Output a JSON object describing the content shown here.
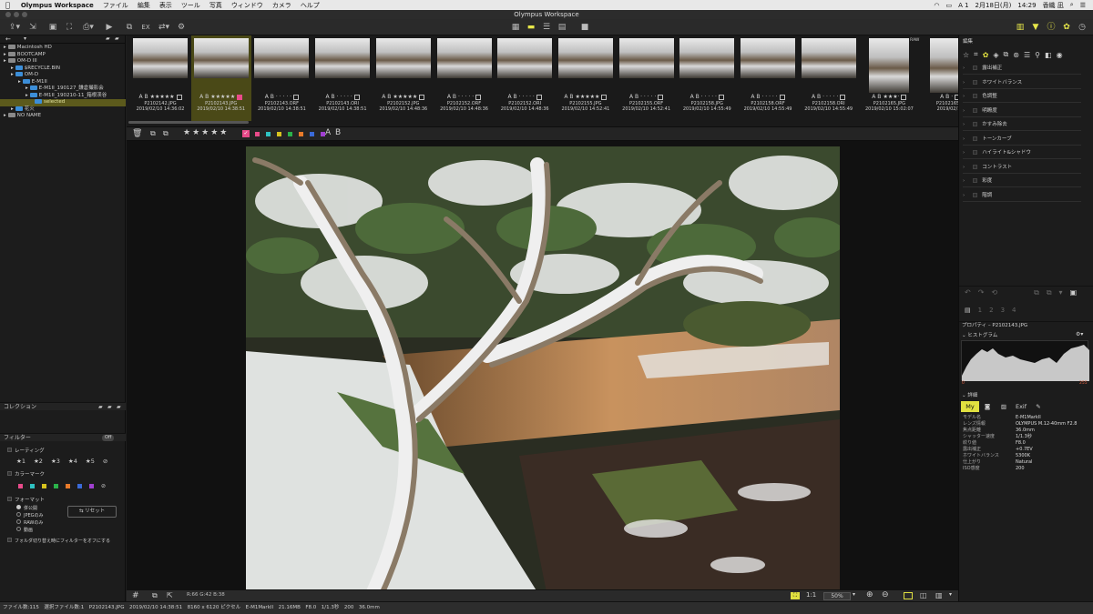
{
  "menubar": {
    "app": "Olympus Workspace",
    "items": [
      "ファイル",
      "編集",
      "表示",
      "ツール",
      "写真",
      "ウィンドウ",
      "カメラ",
      "ヘルプ"
    ],
    "right": [
      "A 1",
      "2月18日(月)",
      "14:29",
      "香織 凪"
    ]
  },
  "window": {
    "title": "Olympus Workspace"
  },
  "tree": [
    {
      "label": "Macintosh HD",
      "level": 1
    },
    {
      "label": "BOOTCAMP",
      "level": 1
    },
    {
      "label": "OM-D III",
      "level": 1
    },
    {
      "label": "$RECYCLE.BIN",
      "level": 2
    },
    {
      "label": "OM-D",
      "level": 2
    },
    {
      "label": "E-M1II",
      "level": 3
    },
    {
      "label": "E-M1II_190127_鎌倉撮影会",
      "level": 4
    },
    {
      "label": "E-M1II_190210-11_箱根渓谷",
      "level": 4
    },
    {
      "label": "selected",
      "level": 5,
      "selected": true
    },
    {
      "label": "花火",
      "level": 2
    },
    {
      "label": "NO NAME",
      "level": 1
    }
  ],
  "collection": {
    "title": "コレクション"
  },
  "filter": {
    "title": "フィルター",
    "toggle": "Off",
    "rating_label": "レーティング",
    "ratings": [
      "★1",
      "★2",
      "★3",
      "★4",
      "★5"
    ],
    "colormark_label": "カラーマーク",
    "colors": [
      "#e84b8a",
      "#2ec2c2",
      "#d6c21e",
      "#2bb24a",
      "#e87a2a",
      "#3a6ad8",
      "#a040d0"
    ],
    "format_label": "フォーマット",
    "formats": [
      "併公開",
      "JPEGのみ",
      "RAWのみ",
      "動画"
    ],
    "reset": "リセット",
    "folder_note": "フォルダ切り替え時にフィルターをオフにする"
  },
  "thumbs": [
    {
      "name": "P2102142.JPG",
      "date": "2019/02/10 14:36:02",
      "stars": "★★★★★"
    },
    {
      "name": "P2102143.JPG",
      "date": "2019/02/10 14:38:51",
      "stars": "★★★★★",
      "selected": true
    },
    {
      "name": "P2102143.ORF",
      "date": "2019/02/10 14:38:51",
      "stars": "· · · · ·"
    },
    {
      "name": "P2102143.ORI",
      "date": "2019/02/10 14:38:51",
      "stars": "· · · · ·"
    },
    {
      "name": "P2102152.JPG",
      "date": "2019/02/10 14:48:36",
      "stars": "★★★★★"
    },
    {
      "name": "P2102152.ORF",
      "date": "2019/02/10 14:48:36",
      "stars": "· · · · ·"
    },
    {
      "name": "P2102152.ORI",
      "date": "2019/02/10 14:48:36",
      "stars": "· · · · ·"
    },
    {
      "name": "P2102155.JPG",
      "date": "2019/02/10 14:52:41",
      "stars": "★★★★★"
    },
    {
      "name": "P2102155.ORF",
      "date": "2019/02/10 14:52:41",
      "stars": "· · · · ·"
    },
    {
      "name": "P2102158.JPG",
      "date": "2019/02/10 14:55:49",
      "stars": "· · · · ·"
    },
    {
      "name": "P2102158.ORF",
      "date": "2019/02/10 14:55:49",
      "stars": "· · · · ·"
    },
    {
      "name": "P2102158.ORI",
      "date": "2019/02/10 14:55:49",
      "stars": "· · · · ·"
    },
    {
      "name": "P2102165.JPG",
      "date": "2019/02/10 15:02:07",
      "stars": "★★★·",
      "badge": "RAW"
    },
    {
      "name": "P2102165.C",
      "date": "2019/02/10",
      "stars": "·"
    }
  ],
  "viewer": {
    "zoom": "50%",
    "readout": "R:66 G:42 B:38"
  },
  "adjust": {
    "title": "編集",
    "items": [
      "露出補正",
      "ホワイトバランス",
      "色調整",
      "明瞭度",
      "かすみ除去",
      "トーンカーブ",
      "ハイライト&シャドウ",
      "コントラスト",
      "彩度",
      "階調"
    ]
  },
  "props": {
    "title": "プロパティ – P2102143.JPG",
    "histogram": "ヒストグラム",
    "hist_low": "0",
    "hist_high": "255",
    "details": "詳細",
    "tabs": [
      "My",
      "",
      "",
      "Exif",
      ""
    ],
    "rows": [
      {
        "k": "モデル名",
        "v": "E-M1MarkII"
      },
      {
        "k": "レンズ情報",
        "v": "OLYMPUS M.12-40mm F2.8"
      },
      {
        "k": "焦点距離",
        "v": "36.0mm"
      },
      {
        "k": "シャッター速度",
        "v": "1/1.3秒"
      },
      {
        "k": "絞り値",
        "v": "F8.0"
      },
      {
        "k": "露出補正",
        "v": "+0.7EV"
      },
      {
        "k": "ホワイトバランス",
        "v": "5300K"
      },
      {
        "k": "仕上がり",
        "v": "Natural"
      },
      {
        "k": "ISO感度",
        "v": "200"
      }
    ]
  },
  "status": "ファイル数:115　選択ファイル数:1　P2102143.JPG　2019/02/10 14:38:51　8160 x 6120 ピクセル　E-M1MarkII　21.16MB　F8.0　1/1.3秒　200　36.0mm"
}
